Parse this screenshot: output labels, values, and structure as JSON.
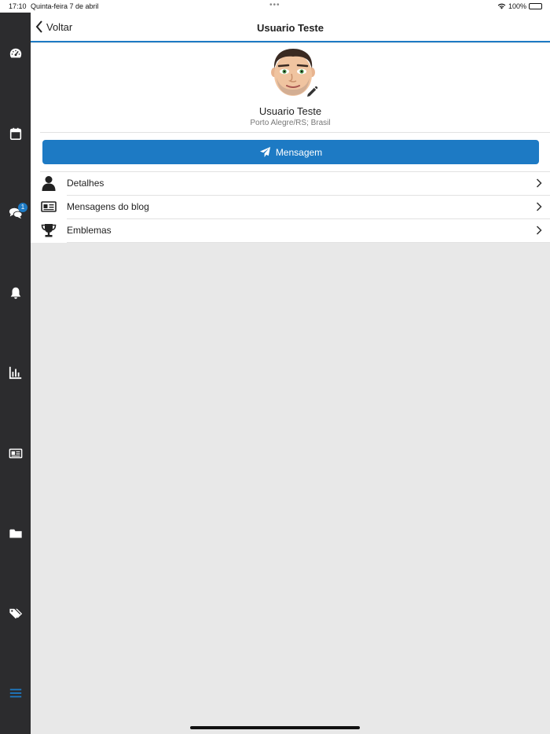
{
  "status_bar": {
    "time": "17:10",
    "date": "Quinta-feira 7 de abril",
    "dots": "•••",
    "battery": "100%"
  },
  "sidebar": {
    "items": [
      {
        "icon": "dashboard-icon"
      },
      {
        "icon": "calendar-icon"
      },
      {
        "icon": "chat-icon",
        "badge": "1"
      },
      {
        "icon": "bell-icon"
      },
      {
        "icon": "bar-chart-icon"
      },
      {
        "icon": "newspaper-icon"
      },
      {
        "icon": "folder-icon"
      },
      {
        "icon": "tags-icon"
      },
      {
        "icon": "menu-icon"
      }
    ],
    "accent": "#1d7ac4"
  },
  "header": {
    "back_label": "Voltar",
    "title": "Usuario Teste"
  },
  "profile": {
    "name": "Usuario Teste",
    "location": "Porto Alegre/RS; Brasil",
    "message_button": "Mensagem"
  },
  "menu": [
    {
      "icon": "user-icon",
      "label": "Detalhes"
    },
    {
      "icon": "newspaper-icon",
      "label": "Mensagens do blog"
    },
    {
      "icon": "trophy-icon",
      "label": "Emblemas"
    }
  ],
  "colors": {
    "accent": "#1d7ac4",
    "sidebar_bg": "#2c2c2e",
    "content_bg": "#e8e8e8"
  }
}
